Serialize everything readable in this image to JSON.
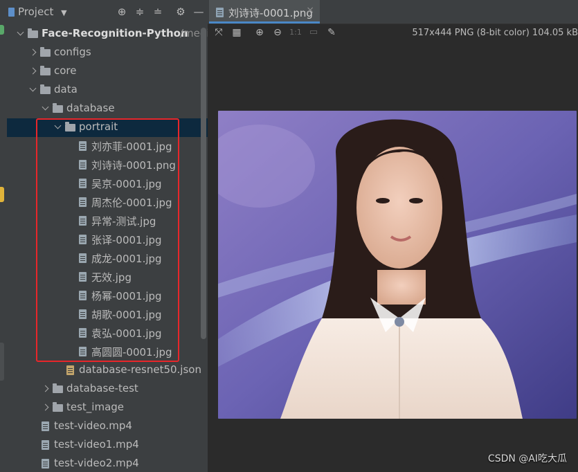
{
  "project_panel": {
    "title": "Project",
    "icons": [
      "target-icon",
      "expand-all-icon",
      "collapse-all-icon",
      "gear-icon",
      "minimize-icon"
    ]
  },
  "tree": [
    {
      "label": "Face-Recognition-Python",
      "path": "/media/dm",
      "type": "root",
      "bold": true,
      "expanded": true
    },
    {
      "label": "configs",
      "type": "folder",
      "expanded": false
    },
    {
      "label": "core",
      "type": "folder",
      "expanded": false
    },
    {
      "label": "data",
      "type": "folder",
      "expanded": true
    },
    {
      "label": "database",
      "type": "folder",
      "expanded": true
    },
    {
      "label": "portrait",
      "type": "folder",
      "expanded": true,
      "selected": true
    },
    {
      "label": "刘亦菲-0001.jpg",
      "type": "file"
    },
    {
      "label": "刘诗诗-0001.png",
      "type": "file"
    },
    {
      "label": "吴京-0001.jpg",
      "type": "file"
    },
    {
      "label": "周杰伦-0001.jpg",
      "type": "file"
    },
    {
      "label": "异常-测试.jpg",
      "type": "file"
    },
    {
      "label": "张译-0001.jpg",
      "type": "file"
    },
    {
      "label": "成龙-0001.jpg",
      "type": "file"
    },
    {
      "label": "无效.jpg",
      "type": "file"
    },
    {
      "label": "杨幂-0001.jpg",
      "type": "file"
    },
    {
      "label": "胡歌-0001.jpg",
      "type": "file"
    },
    {
      "label": "袁弘-0001.jpg",
      "type": "file"
    },
    {
      "label": "高圆圆-0001.jpg",
      "type": "file"
    },
    {
      "label": "database-resnet50.json",
      "type": "json"
    },
    {
      "label": "database-test",
      "type": "folder",
      "expanded": false
    },
    {
      "label": "test_image",
      "type": "folder",
      "expanded": false
    },
    {
      "label": "test-video.mp4",
      "type": "file"
    },
    {
      "label": "test-video1.mp4",
      "type": "file"
    },
    {
      "label": "test-video2.mp4",
      "type": "file"
    }
  ],
  "editor": {
    "tab_label": "刘诗诗-0001.png",
    "tab_close": "×",
    "image_info": "517x444 PNG (8-bit color) 104.05 kB",
    "zoom_label": "1:1",
    "tools": [
      "fit-icon",
      "grid-icon",
      "zoom-in-icon",
      "zoom-out-icon",
      "actual-size-icon",
      "background-icon",
      "color-picker-icon"
    ]
  },
  "watermark": "CSDN @AI吃大瓜",
  "colors": {
    "highlight": "#e8262a",
    "selection": "#0d293e",
    "tab_accent": "#4a88c7"
  }
}
